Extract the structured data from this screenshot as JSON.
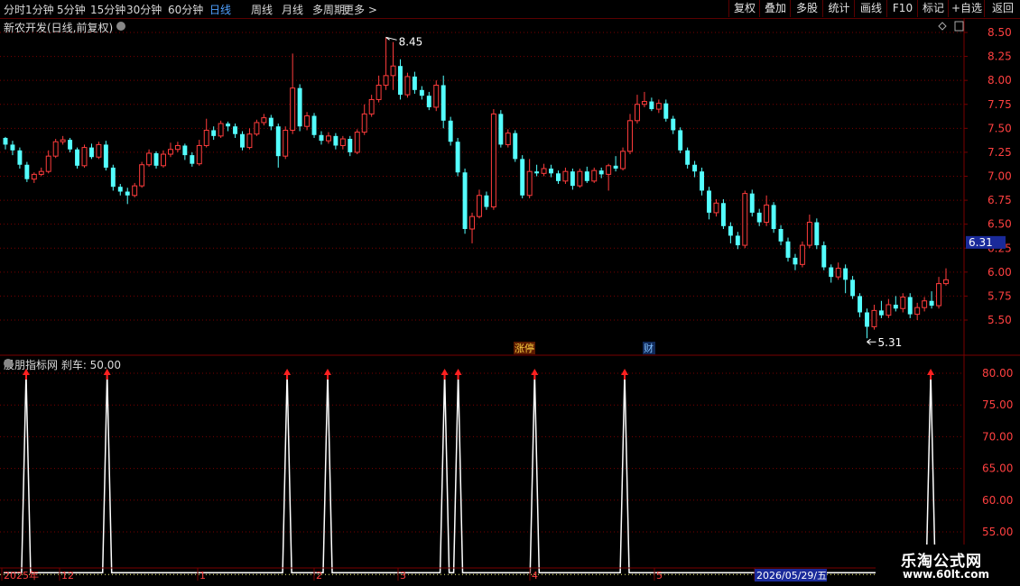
{
  "toolbar": {
    "periods": [
      "分时",
      "1分钟",
      "5分钟",
      "15分钟",
      "30分钟",
      "60分钟",
      "日线",
      "周线",
      "月线",
      "多周期",
      "更多 >"
    ],
    "active_period": "日线",
    "right_buttons": [
      "复权",
      "叠加",
      "多股",
      "统计",
      "画线",
      "F10",
      "标记",
      "+自选",
      "返回"
    ]
  },
  "main_title": "新农开发(日线,前复权)",
  "indicator_title": "股朋指标网 刹车: 50.00",
  "logo": {
    "name": "乐淘公式网",
    "url": "www.60lt.com"
  },
  "colors": {
    "up": "#ff3c3c",
    "down": "#54ffff",
    "grid": "#7a0000",
    "signal": "#ff2020",
    "line": "#ffffff",
    "price_tag_bg": "#1a2a9a"
  },
  "chart_data": [
    {
      "type": "candlestick",
      "title": "新农开发(日线,前复权)",
      "ylim": [
        5.3,
        8.6
      ],
      "y_ticks": [
        "8.50",
        "8.25",
        "8.00",
        "7.75",
        "7.50",
        "7.25",
        "7.00",
        "6.75",
        "6.50",
        "6.25",
        "6.00",
        "5.75",
        "5.50"
      ],
      "current_price": "6.31",
      "high_label": "8.45",
      "low_label": "5.31",
      "event_labels": [
        "涨停",
        "财"
      ],
      "candles": [
        [
          7.4,
          7.33,
          7.41,
          7.28
        ],
        [
          7.33,
          7.27,
          7.37,
          7.22
        ],
        [
          7.27,
          7.12,
          7.3,
          7.08
        ],
        [
          7.12,
          6.97,
          7.15,
          6.94
        ],
        [
          6.97,
          7.02,
          7.04,
          6.93
        ],
        [
          7.02,
          7.05,
          7.09,
          7.0
        ],
        [
          7.05,
          7.21,
          7.27,
          7.03
        ],
        [
          7.21,
          7.36,
          7.39,
          7.19
        ],
        [
          7.36,
          7.38,
          7.42,
          7.33
        ],
        [
          7.38,
          7.28,
          7.4,
          7.25
        ],
        [
          7.28,
          7.11,
          7.3,
          7.08
        ],
        [
          7.11,
          7.3,
          7.33,
          7.09
        ],
        [
          7.3,
          7.2,
          7.34,
          7.18
        ],
        [
          7.2,
          7.33,
          7.36,
          7.18
        ],
        [
          7.33,
          7.09,
          7.37,
          7.06
        ],
        [
          7.09,
          6.89,
          7.12,
          6.85
        ],
        [
          6.89,
          6.84,
          6.92,
          6.8
        ],
        [
          6.84,
          6.8,
          6.88,
          6.71
        ],
        [
          6.8,
          6.9,
          6.93,
          6.78
        ],
        [
          6.9,
          7.12,
          7.15,
          6.88
        ],
        [
          7.12,
          7.24,
          7.28,
          7.1
        ],
        [
          7.24,
          7.11,
          7.26,
          7.08
        ],
        [
          7.11,
          7.23,
          7.27,
          7.09
        ],
        [
          7.23,
          7.28,
          7.35,
          7.2
        ],
        [
          7.28,
          7.32,
          7.36,
          7.25
        ],
        [
          7.32,
          7.22,
          7.34,
          7.17
        ],
        [
          7.22,
          7.13,
          7.25,
          7.1
        ],
        [
          7.13,
          7.32,
          7.38,
          7.11
        ],
        [
          7.32,
          7.48,
          7.6,
          7.3
        ],
        [
          7.48,
          7.42,
          7.52,
          7.38
        ],
        [
          7.42,
          7.55,
          7.58,
          7.4
        ],
        [
          7.55,
          7.52,
          7.57,
          7.47
        ],
        [
          7.52,
          7.44,
          7.55,
          7.4
        ],
        [
          7.44,
          7.3,
          7.47,
          7.27
        ],
        [
          7.3,
          7.44,
          7.5,
          7.28
        ],
        [
          7.44,
          7.56,
          7.59,
          7.42
        ],
        [
          7.56,
          7.61,
          7.65,
          7.53
        ],
        [
          7.61,
          7.52,
          7.64,
          7.48
        ],
        [
          7.52,
          7.21,
          7.55,
          7.09
        ],
        [
          7.21,
          7.48,
          7.52,
          7.18
        ],
        [
          7.48,
          7.92,
          8.28,
          7.44
        ],
        [
          7.92,
          7.52,
          7.96,
          7.47
        ],
        [
          7.52,
          7.63,
          7.67,
          7.48
        ],
        [
          7.63,
          7.43,
          7.66,
          7.4
        ],
        [
          7.43,
          7.37,
          7.47,
          7.33
        ],
        [
          7.37,
          7.42,
          7.46,
          7.34
        ],
        [
          7.42,
          7.32,
          7.45,
          7.28
        ],
        [
          7.32,
          7.39,
          7.42,
          7.28
        ],
        [
          7.39,
          7.25,
          7.42,
          7.21
        ],
        [
          7.25,
          7.46,
          7.49,
          7.23
        ],
        [
          7.46,
          7.65,
          7.75,
          7.43
        ],
        [
          7.65,
          7.8,
          7.85,
          7.62
        ],
        [
          7.8,
          7.95,
          8.05,
          7.77
        ],
        [
          7.95,
          8.05,
          8.45,
          7.9
        ],
        [
          8.05,
          8.15,
          8.4,
          7.9
        ],
        [
          8.15,
          7.85,
          8.22,
          7.8
        ],
        [
          7.85,
          8.04,
          8.08,
          7.82
        ],
        [
          8.04,
          7.9,
          8.09,
          7.86
        ],
        [
          7.9,
          7.84,
          7.94,
          7.8
        ],
        [
          7.84,
          7.72,
          7.88,
          7.69
        ],
        [
          7.72,
          7.95,
          8.0,
          7.68
        ],
        [
          7.95,
          7.58,
          8.05,
          7.5
        ],
        [
          7.58,
          7.36,
          7.62,
          7.32
        ],
        [
          7.36,
          7.04,
          7.4,
          7.0
        ],
        [
          7.04,
          6.45,
          7.08,
          6.4
        ],
        [
          6.45,
          6.58,
          6.62,
          6.3
        ],
        [
          6.58,
          6.8,
          6.86,
          6.56
        ],
        [
          6.8,
          6.68,
          6.84,
          6.65
        ],
        [
          6.68,
          7.65,
          7.7,
          6.65
        ],
        [
          7.65,
          7.33,
          7.69,
          7.3
        ],
        [
          7.33,
          7.45,
          7.49,
          7.3
        ],
        [
          7.45,
          7.18,
          7.48,
          7.15
        ],
        [
          7.18,
          6.8,
          7.22,
          6.77
        ],
        [
          6.8,
          7.05,
          7.18,
          6.77
        ],
        [
          7.05,
          7.03,
          7.12,
          7.0
        ],
        [
          7.03,
          7.08,
          7.13,
          7.0
        ],
        [
          7.08,
          7.03,
          7.12,
          6.99
        ],
        [
          7.03,
          6.95,
          7.06,
          6.92
        ],
        [
          6.95,
          7.05,
          7.09,
          6.92
        ],
        [
          7.05,
          6.9,
          7.08,
          6.86
        ],
        [
          6.9,
          7.05,
          7.08,
          6.88
        ],
        [
          7.05,
          6.95,
          7.1,
          6.93
        ],
        [
          6.95,
          7.06,
          7.09,
          6.93
        ],
        [
          7.06,
          7.02,
          7.09,
          6.98
        ],
        [
          7.02,
          7.11,
          7.13,
          6.85
        ],
        [
          7.11,
          7.08,
          7.21,
          7.05
        ],
        [
          7.08,
          7.26,
          7.3,
          7.06
        ],
        [
          7.26,
          7.58,
          7.65,
          7.23
        ],
        [
          7.58,
          7.75,
          7.85,
          7.55
        ],
        [
          7.75,
          7.78,
          7.88,
          7.72
        ],
        [
          7.78,
          7.7,
          7.82,
          7.68
        ],
        [
          7.7,
          7.76,
          7.8,
          7.66
        ],
        [
          7.76,
          7.6,
          7.8,
          7.57
        ],
        [
          7.6,
          7.48,
          7.63,
          7.44
        ],
        [
          7.48,
          7.27,
          7.51,
          7.24
        ],
        [
          7.27,
          7.12,
          7.3,
          7.08
        ],
        [
          7.12,
          7.05,
          7.16,
          6.99
        ],
        [
          7.05,
          6.85,
          7.09,
          6.8
        ],
        [
          6.85,
          6.62,
          6.89,
          6.55
        ],
        [
          6.62,
          6.72,
          6.76,
          6.58
        ],
        [
          6.72,
          6.48,
          6.76,
          6.45
        ],
        [
          6.48,
          6.38,
          6.52,
          6.3
        ],
        [
          6.38,
          6.28,
          6.42,
          6.24
        ],
        [
          6.28,
          6.82,
          6.85,
          6.25
        ],
        [
          6.82,
          6.62,
          6.86,
          6.58
        ],
        [
          6.62,
          6.52,
          6.66,
          6.48
        ],
        [
          6.52,
          6.7,
          6.8,
          6.48
        ],
        [
          6.7,
          6.45,
          6.73,
          6.41
        ],
        [
          6.45,
          6.32,
          6.49,
          6.28
        ],
        [
          6.32,
          6.15,
          6.36,
          6.11
        ],
        [
          6.15,
          6.08,
          6.19,
          6.02
        ],
        [
          6.08,
          6.28,
          6.32,
          6.05
        ],
        [
          6.28,
          6.52,
          6.6,
          6.25
        ],
        [
          6.52,
          6.28,
          6.56,
          6.24
        ],
        [
          6.28,
          6.05,
          6.32,
          6.02
        ],
        [
          6.05,
          5.95,
          6.08,
          5.89
        ],
        [
          5.95,
          6.04,
          6.1,
          5.92
        ],
        [
          6.04,
          5.92,
          6.08,
          5.78
        ],
        [
          5.92,
          5.75,
          5.96,
          5.72
        ],
        [
          5.75,
          5.58,
          5.78,
          5.53
        ],
        [
          5.58,
          5.43,
          5.62,
          5.31
        ],
        [
          5.43,
          5.6,
          5.66,
          5.4
        ],
        [
          5.6,
          5.55,
          5.7,
          5.52
        ],
        [
          5.55,
          5.66,
          5.72,
          5.52
        ],
        [
          5.66,
          5.62,
          5.75,
          5.59
        ],
        [
          5.62,
          5.74,
          5.78,
          5.58
        ],
        [
          5.74,
          5.56,
          5.78,
          5.52
        ],
        [
          5.56,
          5.63,
          5.68,
          5.5
        ],
        [
          5.63,
          5.7,
          5.74,
          5.59
        ],
        [
          5.7,
          5.65,
          5.8,
          5.62
        ],
        [
          5.65,
          5.88,
          5.95,
          5.62
        ],
        [
          5.88,
          5.92,
          6.04,
          5.86
        ]
      ]
    },
    {
      "type": "line",
      "title": "股朋指标网 刹车: 50.00",
      "ylim": [
        50,
        80
      ],
      "y_ticks": [
        "80.00",
        "75.00",
        "70.00",
        "65.00",
        "60.00",
        "55.00"
      ],
      "baseline": 50,
      "peak": 80,
      "signal_indices": [
        5,
        23,
        63,
        72,
        98,
        101,
        118,
        138,
        206
      ],
      "x_ticks": [
        "2025年",
        "12",
        "1",
        "2",
        "3",
        "4",
        "5",
        "2026/05/29/五"
      ]
    }
  ]
}
